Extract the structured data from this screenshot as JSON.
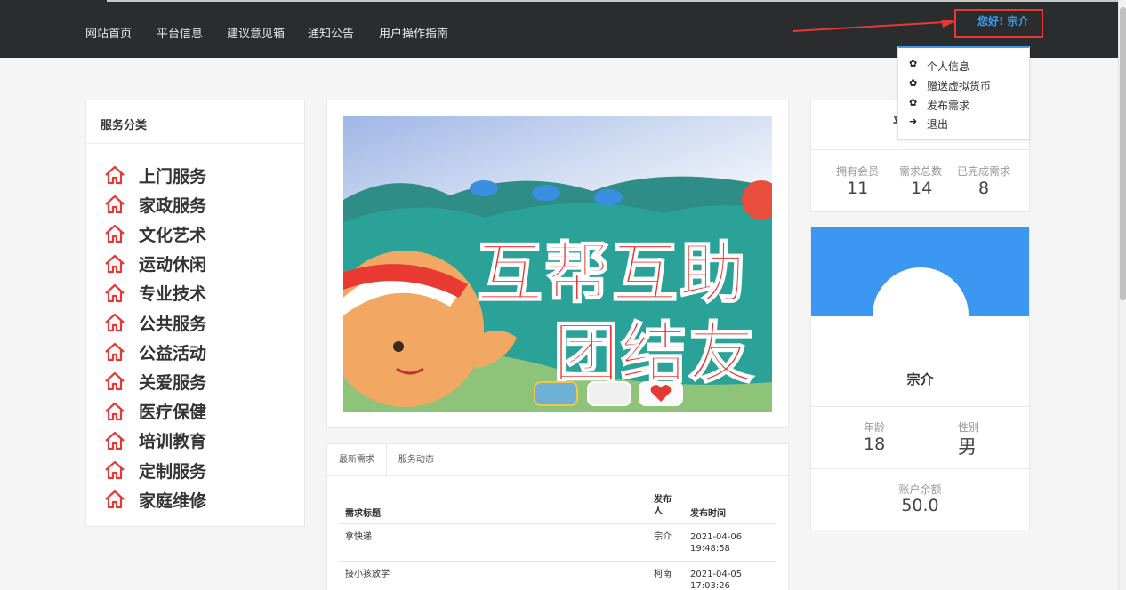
{
  "nav": {
    "items": [
      "网站首页",
      "平台信息",
      "建议意见箱",
      "通知公告",
      "用户操作指南"
    ],
    "greeting": "您好! 宗介"
  },
  "dropdown": {
    "items": [
      "个人信息",
      "赠送虚拟货币",
      "发布需求",
      "退出"
    ],
    "icons": [
      "gear-icon",
      "gear-icon",
      "gear-icon",
      "logout-icon"
    ]
  },
  "categories": {
    "title": "服务分类",
    "icon": "home-icon",
    "items": [
      "上门服务",
      "家政服务",
      "文化艺术",
      "运动休闲",
      "专业技术",
      "公共服务",
      "公益活动",
      "关爱服务",
      "医疗保健",
      "培训教育",
      "定制服务",
      "家庭维修"
    ]
  },
  "banner": {
    "line1": "互帮互助",
    "line2": "团结友"
  },
  "demands": {
    "tabs": [
      "最新需求",
      "服务动态"
    ],
    "headers": {
      "title": "需求标题",
      "publisher": "发布人",
      "time": "发布时间"
    },
    "rows": [
      {
        "title": "拿快递",
        "publisher": "宗介",
        "date": "2021-04-06",
        "time": "19:48:58"
      },
      {
        "title": "接小孩放学",
        "publisher": "柯南",
        "date": "2021-04-05",
        "time": "17:03:26"
      }
    ]
  },
  "stats": {
    "partial_title": "平",
    "labels": [
      "拥有会员",
      "需求总数",
      "已完成需求"
    ],
    "values": [
      "11",
      "14",
      "8"
    ]
  },
  "profile": {
    "name": "宗介",
    "age_label": "年龄",
    "age": "18",
    "gender_label": "性别",
    "gender": "男",
    "balance_label": "账户余额",
    "balance": "50.0"
  },
  "colors": {
    "accent": "#3b97f2",
    "navbar": "#2b2c2e",
    "highlight": "#e53935",
    "icon_red": "#e53935"
  }
}
